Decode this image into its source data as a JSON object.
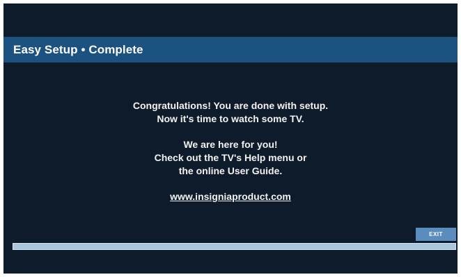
{
  "header": {
    "title": "Easy Setup • Complete"
  },
  "message": {
    "lines_1": [
      "Congratulations! You are done with setup.",
      "Now it's time to watch some TV."
    ],
    "lines_2": [
      "We are here for you!",
      "Check out the TV's Help menu or",
      "the online User Guide."
    ],
    "url": "www.insigniaproduct.com"
  },
  "exit_label": "EXIT",
  "progress": {
    "fraction": 1.0
  },
  "colors": {
    "background": "#0e1b2b",
    "title_bar": "#1c5280",
    "exit_button": "#5a8cc0",
    "progress": "#a9c6df"
  }
}
